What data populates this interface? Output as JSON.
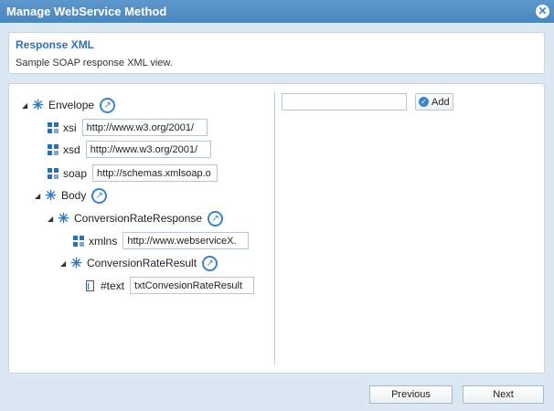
{
  "dialog": {
    "title": "Manage WebService Method"
  },
  "header": {
    "title": "Response XML",
    "description": "Sample SOAP response XML view."
  },
  "tree": {
    "envelope": {
      "label": "Envelope"
    },
    "xsi": {
      "label": "xsi",
      "value": "http://www.w3.org/2001/"
    },
    "xsd": {
      "label": "xsd",
      "value": "http://www.w3.org/2001/"
    },
    "soap": {
      "label": "soap",
      "value": "http://schemas.xmlsoap.o"
    },
    "body": {
      "label": "Body"
    },
    "conversion_rate_response": {
      "label": "ConversionRateResponse"
    },
    "xmlns": {
      "label": "xmlns",
      "value": "http://www.webserviceX."
    },
    "conversion_rate_result": {
      "label": "ConversionRateResult"
    },
    "text": {
      "label": "#text",
      "value": "txtConvesionRateResult"
    }
  },
  "add_panel": {
    "input_value": "",
    "add_label": "Add"
  },
  "footer": {
    "previous_label": "Previous",
    "next_label": "Next"
  },
  "colors": {
    "titlebar": "#4a86bf",
    "accent": "#2f72b0",
    "background": "#dbe8f3"
  },
  "icons": {
    "element": "asterisk-node-icon",
    "attribute": "grid-attribute-icon",
    "text": "document-icon",
    "edit": "pin-edit-icon",
    "close": "close-icon",
    "add": "check-icon"
  }
}
